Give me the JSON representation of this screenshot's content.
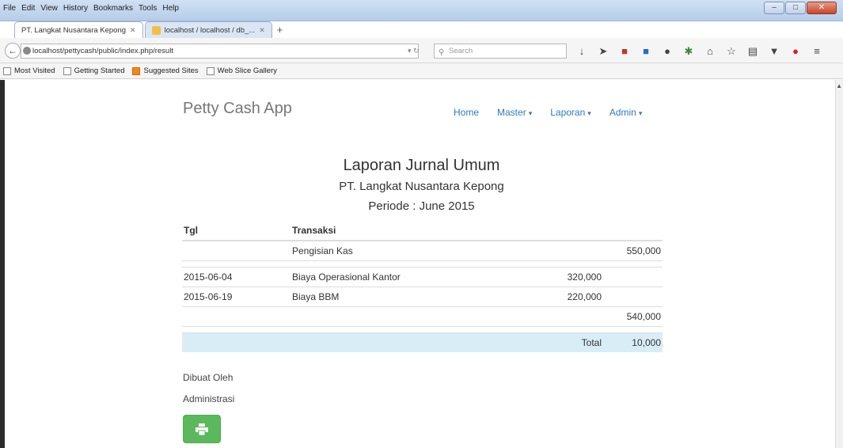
{
  "browser": {
    "menu": [
      "File",
      "Edit",
      "View",
      "History",
      "Bookmarks",
      "Tools",
      "Help"
    ],
    "tabs": [
      {
        "label": "PT. Langkat Nusantara Kepong"
      },
      {
        "label": "localhost / localhost / db_..."
      }
    ],
    "url": "localhost/pettycash/public/index.php/result",
    "search_placeholder": "Search",
    "bookmarks": [
      "Most Visited",
      "Getting Started",
      "Suggested Sites",
      "Web Slice Gallery"
    ]
  },
  "app": {
    "brand": "Petty Cash App",
    "nav": [
      {
        "label": "Home",
        "dropdown": false
      },
      {
        "label": "Master",
        "dropdown": true
      },
      {
        "label": "Laporan",
        "dropdown": true
      },
      {
        "label": "Admin",
        "dropdown": true
      }
    ]
  },
  "report": {
    "title": "Laporan Jurnal Umum",
    "company": "PT. Langkat Nusantara Kepong",
    "period": "Periode : June 2015",
    "headers": {
      "tgl": "Tgl",
      "transaksi": "Transaksi"
    },
    "rows": [
      {
        "tgl": "",
        "transaksi": "Pengisian Kas",
        "debit": "",
        "kredit": "550,000"
      },
      {
        "tgl": "2015-06-04",
        "transaksi": "Biaya Operasional Kantor",
        "debit": "320,000",
        "kredit": ""
      },
      {
        "tgl": "2015-06-19",
        "transaksi": "Biaya BBM",
        "debit": "220,000",
        "kredit": ""
      },
      {
        "tgl": "",
        "transaksi": "",
        "debit": "",
        "kredit": "540,000"
      }
    ],
    "total_label": "Total",
    "total_value": "10,000",
    "signed_by_label": "Dibuat Oleh",
    "signed_by_role": "Administrasi"
  },
  "colors": {
    "link": "#337ab7",
    "print_button": "#5cb85c",
    "total_row": "#d9edf7"
  }
}
